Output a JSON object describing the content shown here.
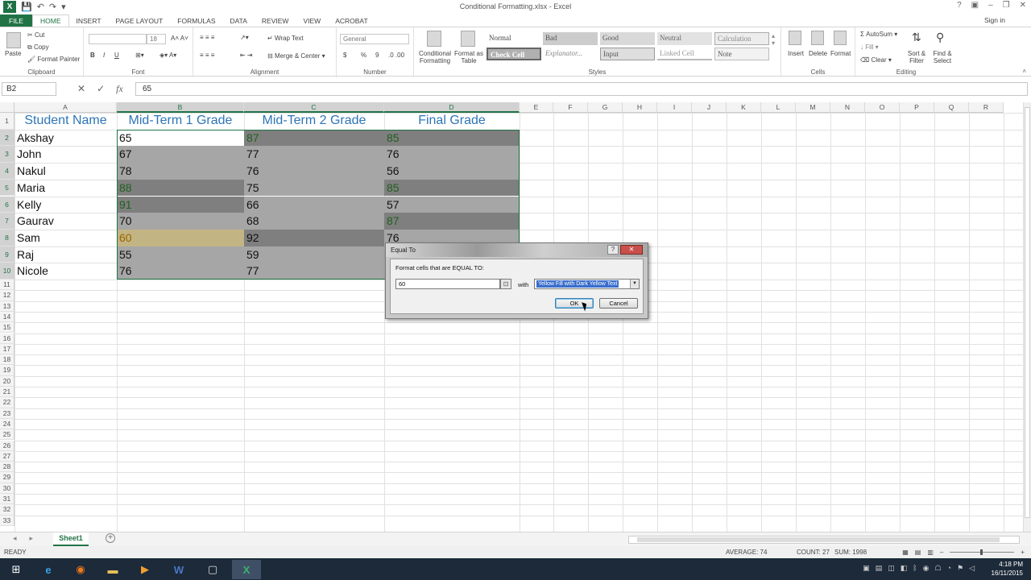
{
  "window": {
    "title": "Conditional Formatting.xlsx - Excel",
    "signin": "Sign in"
  },
  "qat": {
    "save": "💾",
    "undo": "↶",
    "redo": "↷",
    "more": "▾"
  },
  "tabs": [
    {
      "label": "FILE"
    },
    {
      "label": "HOME"
    },
    {
      "label": "INSERT"
    },
    {
      "label": "PAGE LAYOUT"
    },
    {
      "label": "FORMULAS"
    },
    {
      "label": "DATA"
    },
    {
      "label": "REVIEW"
    },
    {
      "label": "VIEW"
    },
    {
      "label": "ACROBAT"
    }
  ],
  "ribbon": {
    "clipboard": {
      "label": "Clipboard",
      "paste": "Paste",
      "cut": "Cut",
      "copy": "Copy",
      "format_painter": "Format Painter"
    },
    "font": {
      "label": "Font",
      "font_name": "",
      "font_size": "18",
      "bold": "B",
      "italic": "I",
      "underline": "U"
    },
    "alignment": {
      "label": "Alignment",
      "wrap_text": "Wrap Text",
      "merge_center": "Merge & Center"
    },
    "number": {
      "label": "Number",
      "format": "General",
      "currency": "$",
      "percent": "%",
      "comma": "9"
    },
    "styles": {
      "label": "Styles",
      "conditional_formatting": "Conditional Formatting",
      "format_as_table": "Format as Table",
      "cells": [
        {
          "name": "Normal",
          "bg": "#ffffff",
          "fg": "#222222"
        },
        {
          "name": "Bad",
          "bg": "#cccccc",
          "fg": "#555555"
        },
        {
          "name": "Good",
          "bg": "#d9d9d9",
          "fg": "#555555"
        },
        {
          "name": "Neutral",
          "bg": "#e2e2e2",
          "fg": "#666666"
        },
        {
          "name": "Calculation",
          "bg": "#ededed",
          "fg": "#888888"
        },
        {
          "name": "Check Cell",
          "bg": "#b0b0b0",
          "fg": "#ffffff"
        },
        {
          "name": "Explanator...",
          "bg": "#ffffff",
          "fg": "#888888"
        },
        {
          "name": "Input",
          "bg": "#dedede",
          "fg": "#555555"
        },
        {
          "name": "Linked Cell",
          "bg": "#ffffff",
          "fg": "#999999"
        },
        {
          "name": "Note",
          "bg": "#f2f2f2",
          "fg": "#555555"
        }
      ]
    },
    "cells": {
      "label": "Cells",
      "insert": "Insert",
      "delete": "Delete",
      "format": "Format"
    },
    "editing": {
      "label": "Editing",
      "autosum": "AutoSum",
      "fill": "Fill",
      "clear": "Clear",
      "sort_filter": "Sort & Filter",
      "find_select": "Find & Select"
    }
  },
  "formula_bar": {
    "name_box": "B2",
    "formula": "65",
    "cancel": "✕",
    "enter": "✓",
    "fx": "fx"
  },
  "grid": {
    "columns": [
      "A",
      "B",
      "C",
      "D",
      "E",
      "F",
      "G",
      "H",
      "I",
      "J",
      "K",
      "L",
      "M",
      "N",
      "O",
      "P",
      "Q",
      "R",
      "S"
    ],
    "rows": [
      "1",
      "2",
      "3",
      "4",
      "5",
      "6",
      "7",
      "8",
      "9",
      "10",
      "11",
      "12",
      "13",
      "14",
      "15",
      "16",
      "17",
      "18",
      "19",
      "20",
      "21",
      "22",
      "23",
      "24",
      "25",
      "26",
      "27",
      "28",
      "29",
      "30",
      "31",
      "32",
      "33"
    ],
    "headers": [
      "Student Name",
      "Mid-Term 1 Grade",
      "Mid-Term 2 Grade",
      "Final Grade"
    ],
    "data": [
      {
        "name": "Akshay",
        "m1": "65",
        "m2": "87",
        "f": "85"
      },
      {
        "name": "John",
        "m1": "67",
        "m2": "77",
        "f": "76"
      },
      {
        "name": "Nakul",
        "m1": "78",
        "m2": "76",
        "f": "56"
      },
      {
        "name": "Maria",
        "m1": "88",
        "m2": "75",
        "f": "85"
      },
      {
        "name": "Kelly",
        "m1": "91",
        "m2": "66",
        "f": "57"
      },
      {
        "name": "Gaurav",
        "m1": "70",
        "m2": "68",
        "f": "87"
      },
      {
        "name": "Sam",
        "m1": "60",
        "m2": "92",
        "f": "76"
      },
      {
        "name": "Raj",
        "m1": "55",
        "m2": "59",
        "f": ""
      },
      {
        "name": "Nicole",
        "m1": "76",
        "m2": "77",
        "f": ""
      }
    ]
  },
  "sheets": [
    {
      "label": "Sheet1"
    }
  ],
  "add_sheet": "+",
  "status": {
    "ready": "READY",
    "average": "AVERAGE: 74",
    "count": "COUNT: 27",
    "sum": "SUM: 1998"
  },
  "dialog": {
    "title": "Equal To",
    "prompt": "Format cells that are EQUAL TO:",
    "value": "60",
    "with_label": "with",
    "format_option": "Yellow Fill with Dark Yellow Text",
    "ok": "OK",
    "cancel": "Cancel",
    "help": "?",
    "close": "✕"
  },
  "taskbar": {
    "time": "4:18 PM",
    "date": "16/11/2015"
  }
}
